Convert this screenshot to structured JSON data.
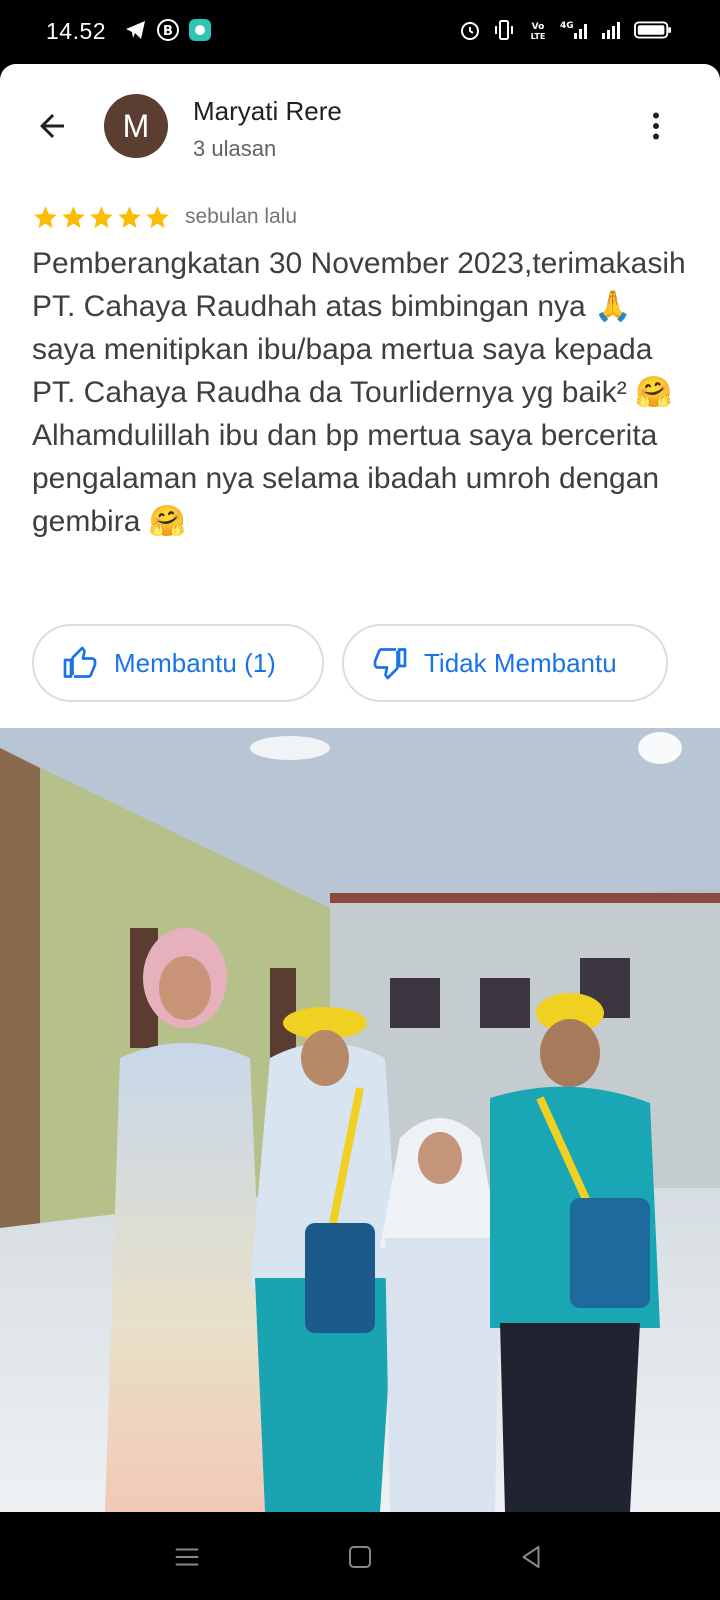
{
  "status_bar": {
    "time": "14.52",
    "left_icons": [
      "telegram-icon",
      "b-circle-icon",
      "app-icon"
    ],
    "right_icons": [
      "alarm-icon",
      "vibrate-icon",
      "volte-icon",
      "4g-signal-icon",
      "signal-icon",
      "battery-icon"
    ]
  },
  "reviewer": {
    "initial": "M",
    "name": "Maryati Rere",
    "review_count": "3 ulasan"
  },
  "review": {
    "rating": 5,
    "time_ago": "sebulan lalu",
    "text": "Pemberangkatan 30 November 2023,terimakasih PT. Cahaya Raudhah atas bimbingan nya 🙏 saya menitipkan ibu/bapa mertua saya kepada PT. Cahaya Raudha da Tourlidernya yg baik² 🤗 Alhamdulillah ibu dan bp mertua saya bercerita pengalaman nya selama ibadah umroh dengan gembira 🤗"
  },
  "actions": {
    "helpful_label": "Membantu (1)",
    "not_helpful_label": "Tidak Membantu"
  },
  "colors": {
    "accent": "#1a73e8",
    "star": "#fbbc04",
    "avatar_bg": "#5b3d31"
  }
}
